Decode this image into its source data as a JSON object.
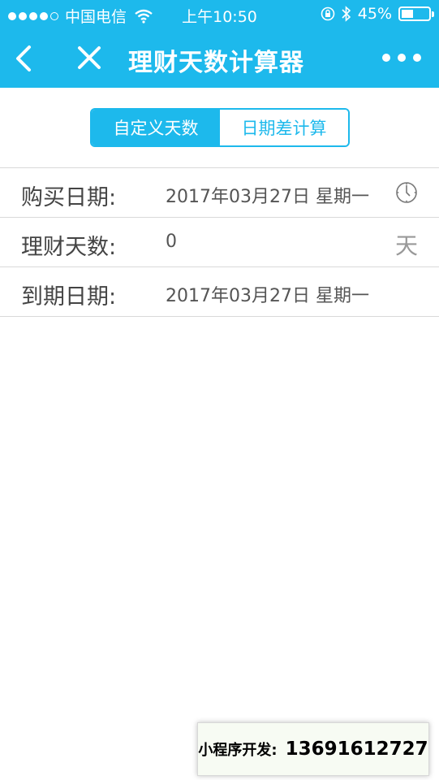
{
  "status_bar": {
    "carrier": "中国电信",
    "time": "上午10:50",
    "battery_percent": "45%",
    "battery_level": 0.45,
    "signal_bars_filled": 4,
    "signal_bars_total": 5
  },
  "nav": {
    "title": "理财天数计算器",
    "back_icon": "chevron-left-icon",
    "close_icon": "close-icon",
    "more_icon": "more-dots-icon"
  },
  "segment": {
    "tabs": [
      {
        "label": "自定义天数",
        "active": true
      },
      {
        "label": "日期差计算",
        "active": false
      }
    ]
  },
  "form": {
    "rows": [
      {
        "label": "购买日期:",
        "value": "2017年03月27日 星期一",
        "icon": "clock-icon"
      },
      {
        "label": "理财天数:",
        "value": "0",
        "suffix": "天"
      },
      {
        "label": "到期日期:",
        "value": "2017年03月27日 星期一"
      }
    ]
  },
  "watermark": {
    "label": "小程序开发:",
    "phone": "13691612727"
  },
  "colors": {
    "accent": "#1db9ec",
    "divider": "#d9d9d9"
  }
}
